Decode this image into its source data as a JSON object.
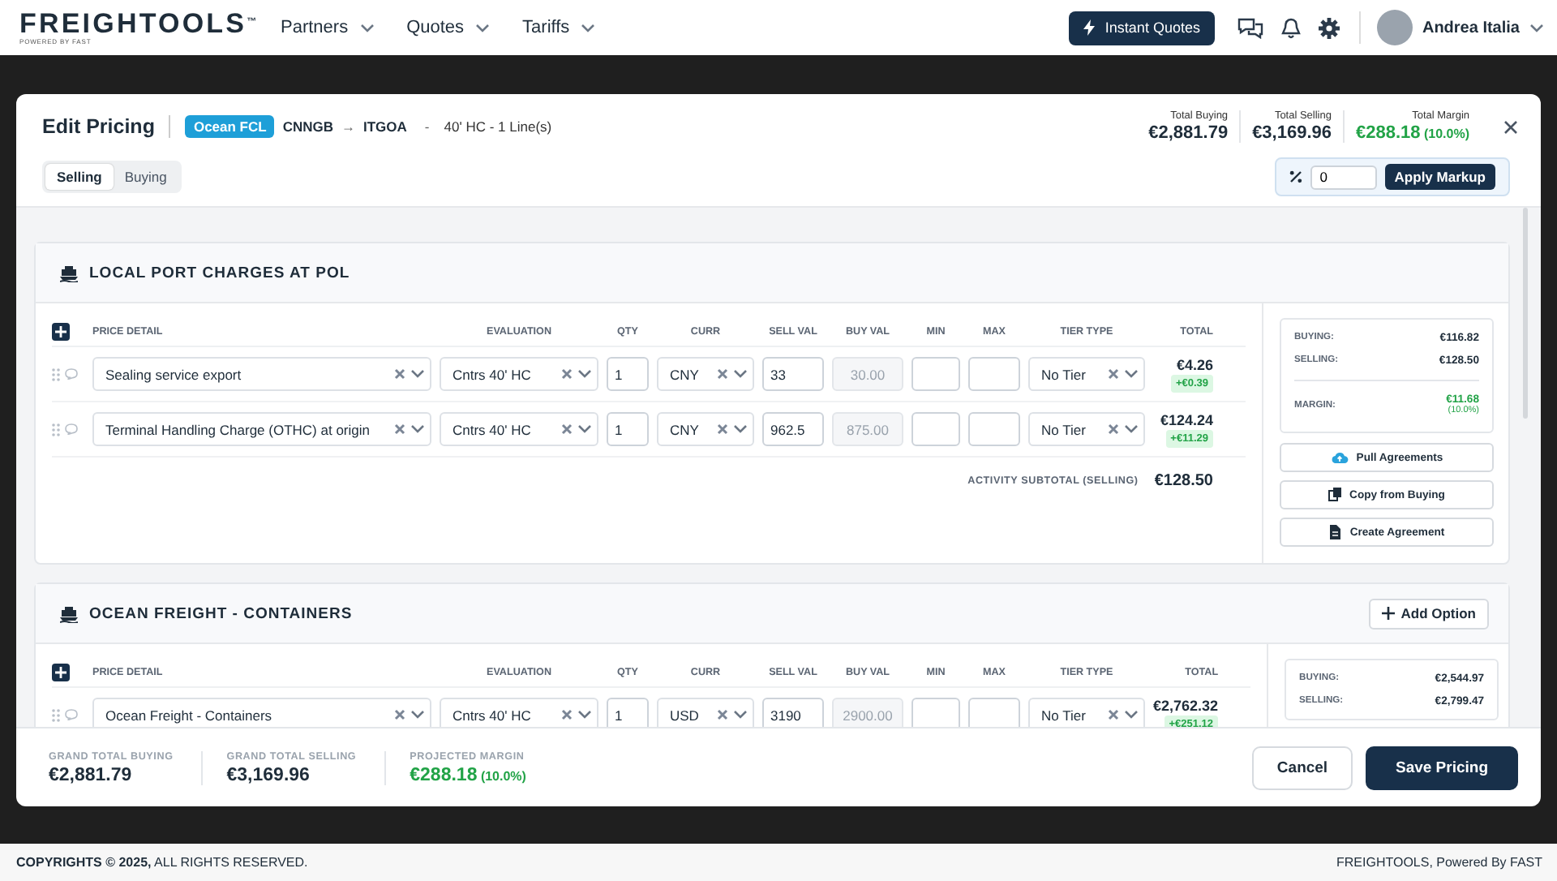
{
  "app_header": {
    "logo": "FREIGHTOOLS",
    "logo_mark": "™",
    "tagline": "POWERED BY FAST",
    "nav": [
      {
        "label": "Partners"
      },
      {
        "label": "Quotes"
      },
      {
        "label": "Tariffs"
      }
    ],
    "instant_quotes": "Instant Quotes",
    "user_name": "Andrea Italia"
  },
  "modal": {
    "title": "Edit Pricing",
    "mode": "Ocean FCL",
    "origin": "CNNGB",
    "arrow": "→",
    "destination": "ITGOA",
    "separator": "-",
    "summary": "40' HC - 1 Line(s)",
    "totals": [
      {
        "label": "Total Buying",
        "value": "€2,881.79",
        "kind": "plain"
      },
      {
        "label": "Total Selling",
        "value": "€3,169.96",
        "kind": "plain"
      },
      {
        "label": "Total Margin",
        "value": "€288.18",
        "percent": "(10.0%)",
        "kind": "margin"
      }
    ],
    "tabs": [
      {
        "label": "Selling",
        "selected": true
      },
      {
        "label": "Buying",
        "selected": false
      }
    ],
    "markup": {
      "value": "0",
      "button": "Apply Markup"
    },
    "sections": [
      {
        "title": "LOCAL PORT CHARGES AT POL",
        "columns": [
          "PRICE DETAIL",
          "EVALUATION",
          "QTY",
          "CURR",
          "SELL VAL",
          "BUY VAL",
          "MIN",
          "MAX",
          "TIER TYPE",
          "TOTAL"
        ],
        "rows": [
          {
            "price_detail": "Sealing service export",
            "evaluation": "Cntrs 40' HC",
            "qty": "1",
            "curr": "CNY",
            "sell_val": "33",
            "buy_val": "30.00",
            "tier": "No Tier",
            "total": "€4.26",
            "delta": "+€0.39"
          },
          {
            "price_detail": "Terminal Handling Charge (OTHC) at origin",
            "evaluation": "Cntrs 40' HC",
            "qty": "1",
            "curr": "CNY",
            "sell_val": "962.5",
            "buy_val": "875.00",
            "tier": "No Tier",
            "total": "€124.24",
            "delta": "+€11.29"
          }
        ],
        "subtotal_label": "ACTIVITY SUBTOTAL (SELLING)",
        "subtotal_value": "€128.50",
        "summary": {
          "buying_label": "BUYING:",
          "buying": "€116.82",
          "selling_label": "SELLING:",
          "selling": "€128.50",
          "margin_label": "MARGIN:",
          "margin": "€11.68",
          "margin_percent": "(10.0%)"
        },
        "actions": [
          {
            "label": "Pull Agreements",
            "kind": "cloud"
          },
          {
            "label": "Copy from Buying",
            "kind": "copy"
          },
          {
            "label": "Create Agreement",
            "kind": "document"
          }
        ]
      },
      {
        "title": "OCEAN FREIGHT - CONTAINERS",
        "add_option": "Add Option",
        "columns": [
          "PRICE DETAIL",
          "EVALUATION",
          "QTY",
          "CURR",
          "SELL VAL",
          "BUY VAL",
          "MIN",
          "MAX",
          "TIER TYPE",
          "TOTAL"
        ],
        "rows": [
          {
            "price_detail": "Ocean Freight - Containers",
            "evaluation": "Cntrs 40' HC",
            "qty": "1",
            "curr": "USD",
            "sell_val": "3190",
            "buy_val": "2900.00",
            "tier": "No Tier",
            "total": "€2,762.32",
            "delta": "+€251.12"
          }
        ],
        "summary": {
          "buying_label": "BUYING:",
          "buying": "€2,544.97",
          "selling_label": "SELLING:",
          "selling": "€2,799.47"
        }
      }
    ],
    "footer": {
      "grand_totals": [
        {
          "label": "GRAND TOTAL BUYING",
          "value": "€2,881.79",
          "kind": "plain"
        },
        {
          "label": "GRAND TOTAL SELLING",
          "value": "€3,169.96",
          "kind": "plain"
        },
        {
          "label": "PROJECTED MARGIN",
          "value": "€288.18",
          "percent": "(10.0%)",
          "kind": "margin"
        }
      ],
      "cancel": "Cancel",
      "save": "Save Pricing"
    }
  },
  "page_footer": {
    "copyright": "**COPYRIGHTS © 2025,** ALL RIGHTS RESERVED.",
    "credit": "FREIGHTOOLS, Powered By FAST"
  }
}
